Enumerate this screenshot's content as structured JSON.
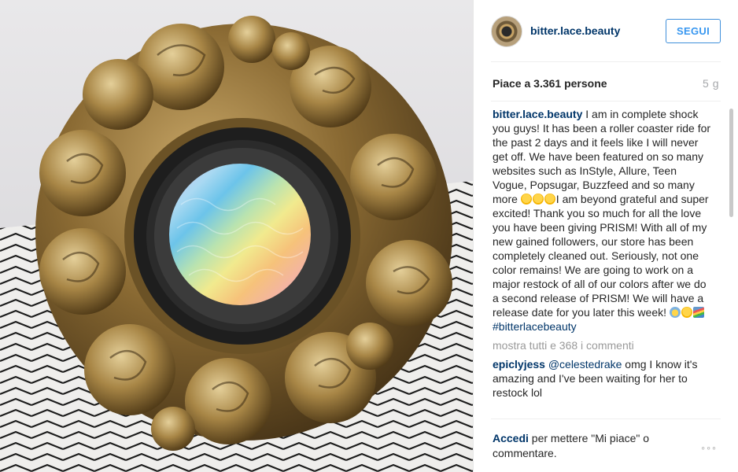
{
  "post": {
    "username": "bitter.lace.beauty",
    "follow_label": "SEGUI",
    "likes_text": "Piace a 3.361 persone",
    "age": "5 g"
  },
  "caption": {
    "username": "bitter.lace.beauty",
    "text_1": " I am in complete shock you guys! It has been a roller coaster ride for the past 2 days and it feels like I will never get off. We have been featured on so many websites such as InStyle, Allure, Teen Vogue, Popsugar, Buzzfeed and so many more ",
    "text_2": "I am beyond grateful and super excited! Thank you so much for all the love you have been giving PRISM! With all of my new gained followers, our store has been completely cleaned out. Seriously, not one color remains! We are going to work on a major restock of all of our colors after we do a second release of PRISM! We will have a release date for you later this week! ",
    "hashtag": "#bitterlacebeauty"
  },
  "comments": {
    "show_all": "mostra tutti e 368 i commenti",
    "items": [
      {
        "username": "epiclyjess",
        "mention": "@celestedrake",
        "text": " omg I know it's amazing and I've been waiting for her to restock lol"
      }
    ]
  },
  "footer": {
    "login_label": "Accedi",
    "login_text": " per mettere \"Mi piace\" o commentare.",
    "more_options": "◦◦◦"
  },
  "icons": {
    "emojis_1": [
      "heart-eyes",
      "heart-eyes",
      "heart-eyes"
    ],
    "emojis_2": [
      "fearful-face",
      "heart-eyes",
      "rainbow"
    ]
  },
  "colors": {
    "link": "#003569",
    "follow": "#3897f0",
    "muted": "#999999"
  }
}
